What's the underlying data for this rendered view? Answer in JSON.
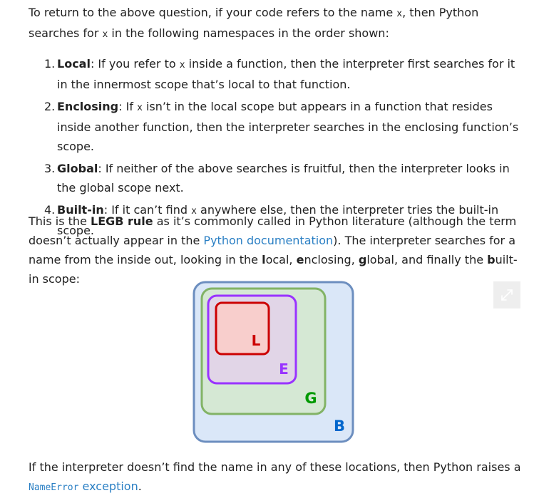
{
  "intro": {
    "text_1": "To return to the above question, if your code refers to the name ",
    "code": "x",
    "text_2": ", then Python searches for ",
    "text_3": " in the following namespaces in the order shown:"
  },
  "list": [
    {
      "number": "1.",
      "term": "Local",
      "text_a": ": If you refer to ",
      "code": "x",
      "text_b": " inside a function, then the interpreter first searches for it in the innermost scope that’s local to that function."
    },
    {
      "number": "2.",
      "term": "Enclosing",
      "text_a": ": If ",
      "code": "x",
      "text_b": " isn’t in the local scope but appears in a function that resides inside another function, then the interpreter searches in the enclosing function’s scope."
    },
    {
      "number": "3.",
      "term": "Global",
      "text_a": ": If neither of the above searches is fruitful, then the interpreter looks in the global scope next."
    },
    {
      "number": "4.",
      "term": "Built-in",
      "text_a": ": If it can’t find ",
      "code": "x",
      "text_b": " anywhere else, then the interpreter tries the built-in scope."
    }
  ],
  "legb": {
    "text_1": "This is the ",
    "bold": "LEGB rule",
    "text_2": " as it’s commonly called in Python literature (although the term doesn’t actually appear in the ",
    "link": "Python documentation",
    "text_3": "). The interpreter searches for a name from the inside out, looking in the ",
    "b_l": "l",
    "s_l": "ocal, ",
    "b_e": "e",
    "s_e": "nclosing, ",
    "b_g": "g",
    "s_g": "lobal, and finally the ",
    "b_b": "b",
    "s_b": "uilt-in scope:"
  },
  "diagram": {
    "labels": {
      "local": "L",
      "enclosing": "E",
      "global": "G",
      "builtin": "B"
    },
    "colors": {
      "builtin_fill": "#dae7f8",
      "builtin_stroke": "#6c8ebf",
      "global_fill": "#d5e8d4",
      "global_stroke": "#82b366",
      "enclosing_fill": "#e1d5e7",
      "enclosing_stroke": "#9933ff",
      "local_fill": "#f8cecc",
      "local_stroke": "#cc0000",
      "label_local": "#cc0000",
      "label_enclosing": "#9933ff",
      "label_global": "#009900",
      "label_builtin": "#0066cc"
    },
    "expand_icon": "expand-icon"
  },
  "outro": {
    "text_1": "If the interpreter doesn’t find the name in any of these locations, then Python raises a ",
    "code": "NameError",
    "link": " exception",
    "text_2": "."
  }
}
